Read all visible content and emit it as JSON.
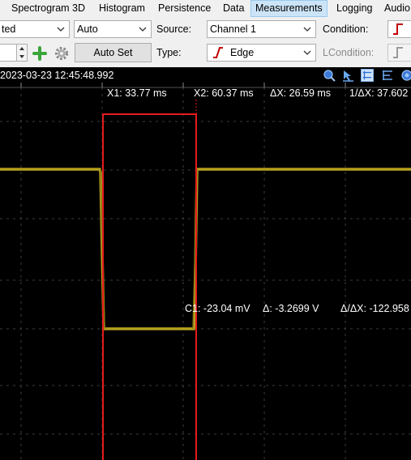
{
  "menu": {
    "items": [
      {
        "label": "Spectrogram 3D",
        "active": false
      },
      {
        "label": "Histogram",
        "active": false
      },
      {
        "label": "Persistence",
        "active": false
      },
      {
        "label": "Data",
        "active": false
      },
      {
        "label": "Measurements",
        "active": true
      },
      {
        "label": "Logging",
        "active": false
      },
      {
        "label": "Audio",
        "active": false
      }
    ]
  },
  "toolbar": {
    "mode_select_value": "ted",
    "auto_select_value": "Auto",
    "source_label": "Source:",
    "source_value": "Channel 1",
    "condition_label": "Condition:",
    "auto_set_label": "Auto Set",
    "type_label": "Type:",
    "type_value": "Edge",
    "lcondition_label": "LCondition:"
  },
  "scope": {
    "timestamp": "2023-03-23 12:45:48.992",
    "cursor_x1": "X1: 33.77 ms",
    "cursor_x2": "X2: 60.37 ms",
    "delta_x": "ΔX: 26.59 ms",
    "inv_delta_x": "1/ΔX: 37.602",
    "cursor_c1": "C1: -23.04 mV",
    "delta_v": "Δ: -3.2699 V",
    "delta_v_over_x": "Δ/ΔX: -122.958"
  },
  "colors": {
    "background": "#000000",
    "grid": "#3c3c3c",
    "trace": "#b5a01e",
    "cursor": "#e51b1b",
    "toolbar_bg": "#f0f0f0",
    "menu_active_bg": "#cce4f7"
  }
}
